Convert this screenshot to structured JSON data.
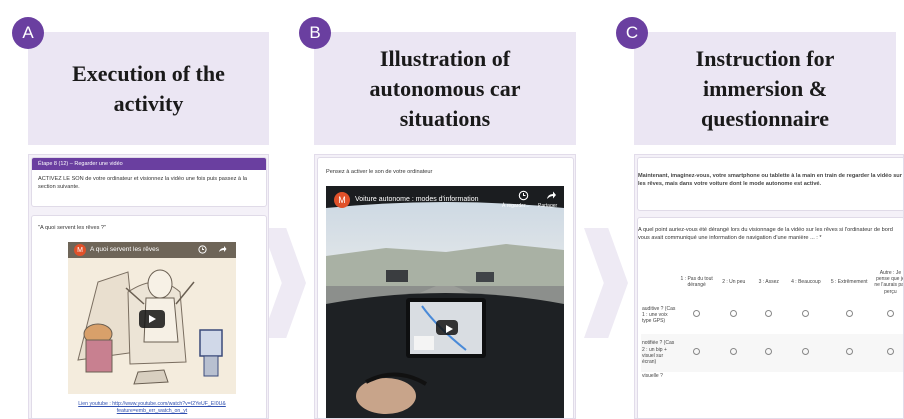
{
  "badges": [
    "A",
    "B",
    "C"
  ],
  "titles": {
    "a": "Execution of the activity",
    "b": "Illustration of autonomous car situations",
    "c": "Instruction for immersion & questionnaire"
  },
  "panel_a": {
    "header": "Étape 8 (12) – Regarder une vidéo",
    "instruction": "ACTIVEZ LE SON de votre ordinateur et visionnez la vidéo une fois puis passez à la section suivante.",
    "question": "\"A quoi servent les rêves ?\"",
    "video_title": "A quoi servent les rêves",
    "avatar": "M",
    "link_line1": "Lien youtube : http://www.youtube.com/watch?v=I2YeUF_EI0U&",
    "link_line2": "feature=emb_err_watch_on_yt"
  },
  "panel_b": {
    "instruction": "Pensez à activer le son de votre ordinateur",
    "video_title": "Voiture autonome : modes d'information",
    "avatar": "M",
    "watch_later": "À regarder...",
    "share": "Partager"
  },
  "panel_c": {
    "intro": "Maintenant, imaginez-vous, votre smartphone ou tablette à la main en train de regarder la vidéo sur les rêves, mais dans votre voiture dont le mode autonome est activé.",
    "question": "A quel point auriez-vous été dérangé lors du visionnage de la vidéo sur les rêves si l'ordinateur de bord vous avait communiqué une information de navigation d'une manière ... : *",
    "columns": [
      "1 : Pas du tout dérangé",
      "2 : Un peu",
      "3 : Assez",
      "4 : Beaucoup",
      "5 : Extrêmement",
      "Autre : Je pense que je ne l'aurais pas perçu"
    ],
    "rows": [
      "auditive ? (Cas 1 : une voix type GPS)",
      "notifiée ? (Cas 2 : un bip + visuel sur écran)",
      "visuelle ?"
    ]
  },
  "colors": {
    "accent": "#6a3fa0",
    "title_bg": "#ebe6f3"
  }
}
